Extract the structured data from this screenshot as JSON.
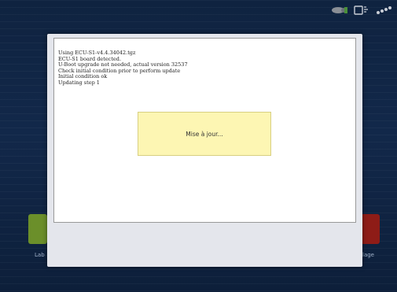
{
  "status_bar": {
    "icons": [
      "gps-signal-icon",
      "display-icon",
      "network-icon"
    ]
  },
  "apps": {
    "left_label": "Lab",
    "right_label": "lage"
  },
  "dialog": {
    "log_lines": [
      "Using ECU-S1-v4.4.34042.tgz",
      "ECU-S1 board detected.",
      "U-Boot upgrade not needed, actual version 32537",
      "Check initial condition prior to perform update",
      "Initial condition ok",
      "Updating step 1"
    ],
    "progress_message": "Mise à jour..."
  },
  "colors": {
    "background": "#12284a",
    "dialog": "#e4e6ec",
    "progress_box": "#fdf6b3",
    "left_tile": "#6b8f2a",
    "right_tile": "#8e1c17"
  }
}
